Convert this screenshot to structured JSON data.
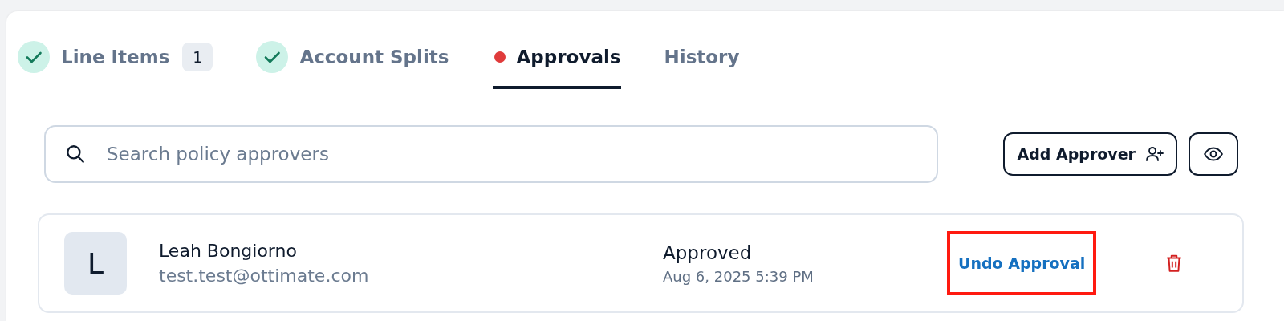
{
  "tabs": [
    {
      "label": "Line Items",
      "selected": false,
      "completed": true,
      "needs_attention": false,
      "count": "1"
    },
    {
      "label": "Account Splits",
      "selected": false,
      "completed": true,
      "needs_attention": false
    },
    {
      "label": "Approvals",
      "selected": true,
      "completed": false,
      "needs_attention": true
    },
    {
      "label": "History",
      "selected": false,
      "completed": false,
      "needs_attention": false
    }
  ],
  "search": {
    "placeholder": "Search policy approvers"
  },
  "toolbar": {
    "add_button": "Add Approver"
  },
  "approvers": [
    {
      "initial": "L",
      "name": "Leah Bongiorno",
      "email": "test.test@ottimate.com",
      "status": "Approved",
      "date": "Aug 6, 2025 5:39 PM",
      "action": "Undo Approval",
      "action_highlighted": true
    }
  ]
}
